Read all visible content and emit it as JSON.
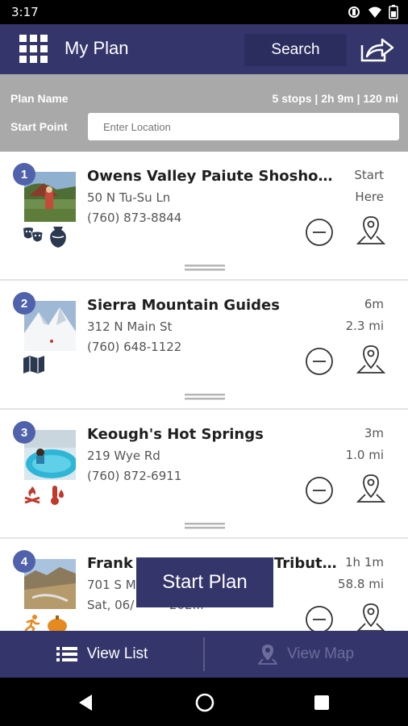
{
  "status_bar": {
    "time": "3:17"
  },
  "header": {
    "title": "My Plan",
    "search_label": "Search"
  },
  "plan": {
    "name_label": "Plan Name",
    "summary": "5 stops | 2h 9m | 120 mi",
    "start_label": "Start Point",
    "start_placeholder": "Enter Location"
  },
  "stops": [
    {
      "number": "1",
      "name": "Owens Valley Paiute Shoshon...",
      "address": "50 N Tu-Su Ln",
      "phone": "(760) 873-8844",
      "meta1": "Start",
      "meta2": "Here",
      "icons": [
        "theater-masks-icon",
        "vase-icon"
      ]
    },
    {
      "number": "2",
      "name": "Sierra Mountain Guides",
      "address": "312 N Main St",
      "phone": "(760) 648-1122",
      "meta1": "6m",
      "meta2": "2.3 mi",
      "icons": [
        "map-icon"
      ]
    },
    {
      "number": "3",
      "name": "Keough's Hot Springs",
      "address": "219 Wye Rd",
      "phone": "(760) 872-6911",
      "meta1": "3m",
      "meta2": "1.0 mi",
      "icons": [
        "campfire-icon",
        "thermometer-icon"
      ]
    },
    {
      "number": "4",
      "name": "Frank",
      "name_tail": "Tribut...",
      "address": "701 S M",
      "phone": "Sat, 06/",
      "phone_tail": "202...",
      "meta1": "1h 1m",
      "meta2": "58.8 mi",
      "icons": [
        "runner-icon",
        "pumpkin-icon"
      ]
    }
  ],
  "start_plan_label": "Start Plan",
  "bottom_nav": {
    "list_label": "View List",
    "map_label": "View Map"
  },
  "colors": {
    "primary": "#34356b",
    "badge": "#5162ad",
    "plan_bar": "#a9a9a9",
    "icon_dark": "#2a3850",
    "icon_red": "#c0392b",
    "icon_orange": "#e58a1f"
  }
}
